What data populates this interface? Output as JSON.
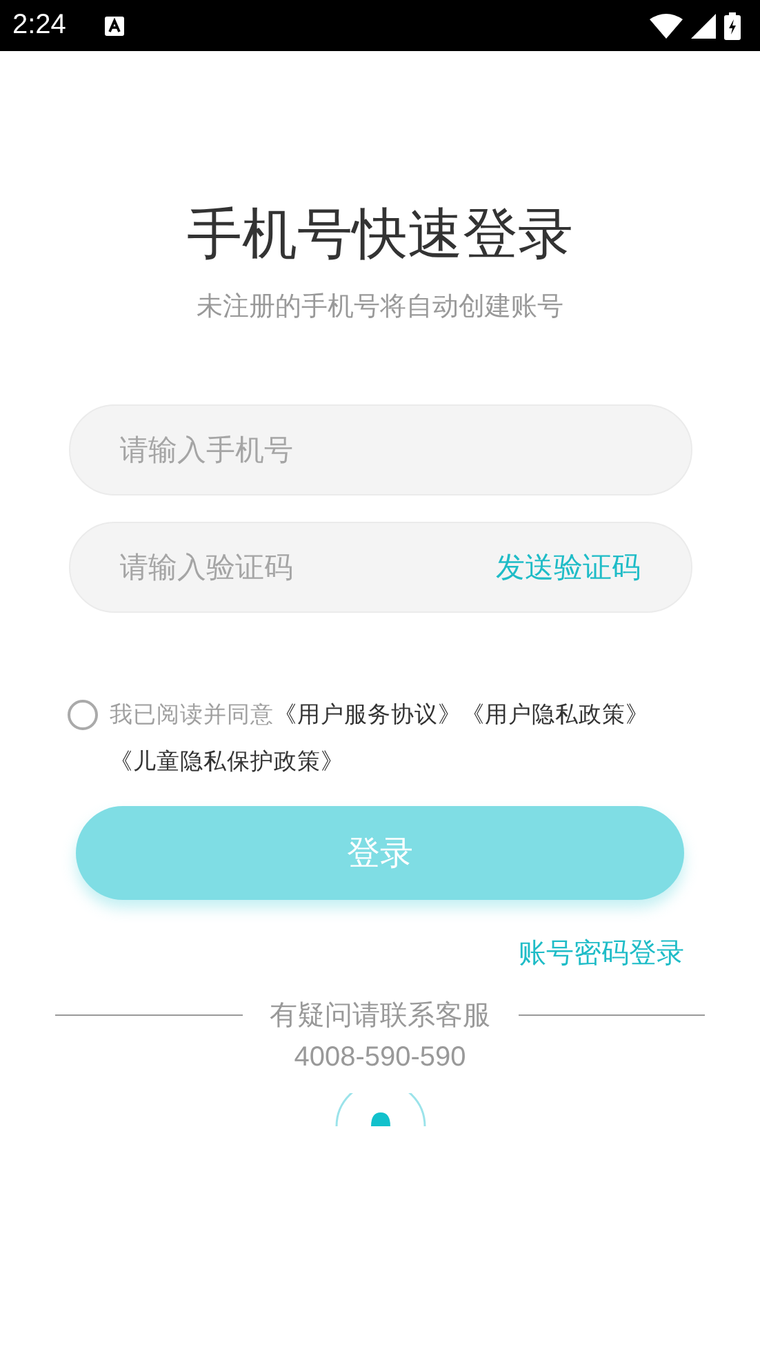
{
  "status_bar": {
    "time": "2:24"
  },
  "title": "手机号快速登录",
  "subtitle": "未注册的手机号将自动创建账号",
  "phone_field": {
    "placeholder": "请输入手机号"
  },
  "code_field": {
    "placeholder": "请输入验证码",
    "action": "发送验证码"
  },
  "agreement": {
    "checked": false,
    "lead": "我已阅读并同意",
    "terms": "《用户服务协议》《用户隐私政策》《儿童隐私保护政策》"
  },
  "login_button": "登录",
  "password_login_link": "账号密码登录",
  "support": {
    "label": "有疑问请联系客服",
    "phone": "4008-590-590"
  }
}
